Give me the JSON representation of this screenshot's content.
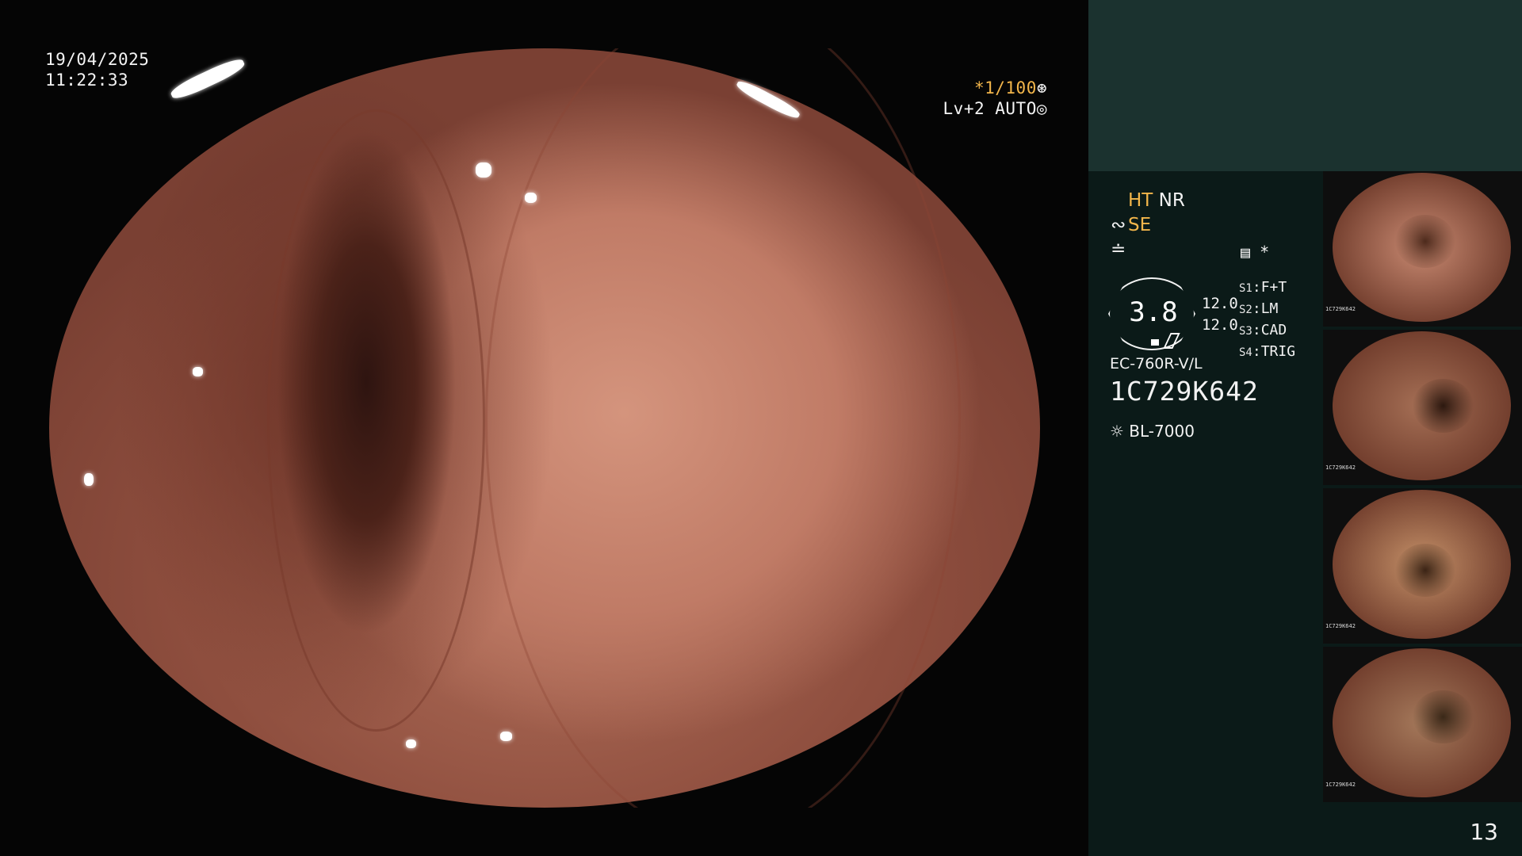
{
  "overlay": {
    "date": "19/04/2025",
    "time": "11:22:33",
    "shutter": "*1/100",
    "shutter_icon": "aperture-icon",
    "level": "Lv+2",
    "exposure_mode": "AUTO",
    "exposure_icon": "iris-icon"
  },
  "settings": {
    "ht_label": "HT",
    "nr_label": "NR",
    "se_label": "SE",
    "menu_glyph": "*"
  },
  "gauge": {
    "value": "3.8",
    "upper": "12.0",
    "lower": "12.0"
  },
  "switches": [
    {
      "key": "S1",
      "value": "F+T"
    },
    {
      "key": "S2",
      "value": "LM"
    },
    {
      "key": "S3",
      "value": "CAD"
    },
    {
      "key": "S4",
      "value": "TRIG"
    }
  ],
  "scope": {
    "model": "EC-760R-V/L",
    "serial": "1C729K642",
    "light_source": "BL-7000"
  },
  "thumbnails": [
    {
      "serial": "1C729K642",
      "tint": "#c98a72",
      "hole": "#4d2a1c"
    },
    {
      "serial": "1C729K642",
      "tint": "#a56f55",
      "hole": "#2c180f"
    },
    {
      "serial": "1C729K642",
      "tint": "#c49068",
      "hole": "#3b2415"
    },
    {
      "serial": "1C729K642",
      "tint": "#a4785a",
      "hole": "#3a2818"
    }
  ],
  "page_number": "13",
  "colors": {
    "panel_top": "#1b322f",
    "panel_body": "#0b1a18",
    "accent_amber": "#f3b64b"
  }
}
